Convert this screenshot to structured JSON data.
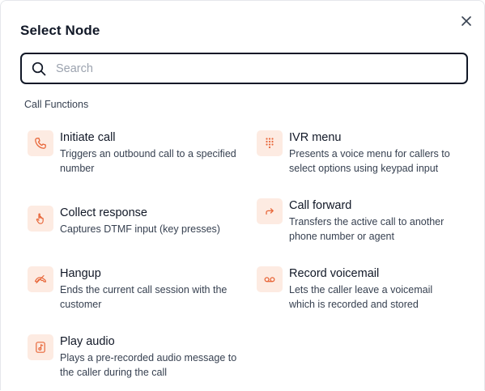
{
  "dialog": {
    "title": "Select Node",
    "close_icon": "close-icon"
  },
  "search": {
    "placeholder": "Search",
    "value": "",
    "icon": "search-icon"
  },
  "section": {
    "title": "Call Functions"
  },
  "nodes": [
    {
      "title": "Initiate call",
      "description": "Triggers an outbound call to a specified number",
      "icon": "phone-icon"
    },
    {
      "title": "IVR menu",
      "description": "Presents a voice menu for callers to select options using keypad input",
      "icon": "keypad-icon"
    },
    {
      "title": "Collect response",
      "description": "Captures DTMF input (key presses)",
      "icon": "hand-pointer-icon"
    },
    {
      "title": "Call forward",
      "description": "Transfers the active call to another phone number or agent",
      "icon": "forward-arrow-icon"
    },
    {
      "title": "Hangup",
      "description": "Ends the current call session with the customer",
      "icon": "phone-hangup-icon"
    },
    {
      "title": "Record voicemail",
      "description": "Lets the caller leave a voicemail which is recorded and stored",
      "icon": "voicemail-icon"
    },
    {
      "title": "Play audio",
      "description": "Plays a pre-recorded audio message to the caller during the call",
      "icon": "audio-file-icon"
    }
  ],
  "colors": {
    "accent": "#e8673a",
    "icon_bg": "#fdebe2",
    "text_primary": "#111827",
    "text_secondary": "#374151",
    "placeholder": "#9ca3af"
  }
}
